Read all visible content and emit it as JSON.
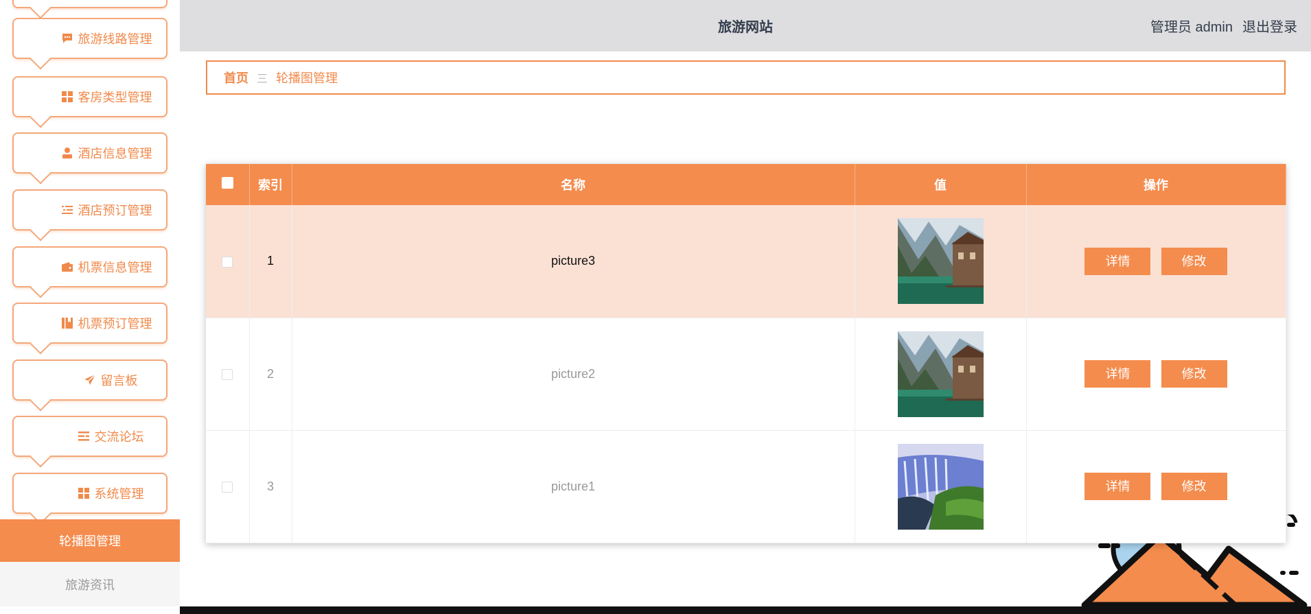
{
  "sidebar": {
    "menu": [
      {
        "label": "旅游线路管理",
        "icon": "message-icon"
      },
      {
        "label": "客房类型管理",
        "icon": "grid-icon"
      },
      {
        "label": "酒店信息管理",
        "icon": "user-icon"
      },
      {
        "label": "酒店预订管理",
        "icon": "list-icon"
      },
      {
        "label": "机票信息管理",
        "icon": "wallet-icon"
      },
      {
        "label": "机票预订管理",
        "icon": "book-icon"
      },
      {
        "label": "留言板",
        "icon": "send-icon"
      },
      {
        "label": "交流论坛",
        "icon": "align-icon"
      },
      {
        "label": "系统管理",
        "icon": "grid-icon"
      }
    ],
    "submenu": [
      {
        "label": "轮播图管理",
        "active": true
      },
      {
        "label": "旅游资讯",
        "active": false
      }
    ]
  },
  "header": {
    "title": "旅游网站",
    "user_label": "管理员 admin",
    "logout_label": "退出登录"
  },
  "breadcrumb": {
    "home": "首页",
    "separator": "三",
    "current": "轮播图管理"
  },
  "table": {
    "columns": [
      "索引",
      "名称",
      "值",
      "操作"
    ],
    "rows": [
      {
        "index": "1",
        "name": "picture3",
        "image": "lake-cabin-photo",
        "highlighted": true
      },
      {
        "index": "2",
        "name": "picture2",
        "image": "lake-cabin-photo",
        "highlighted": false
      },
      {
        "index": "3",
        "name": "picture1",
        "image": "waterfall-photo",
        "highlighted": false
      }
    ],
    "actions": {
      "detail": "详情",
      "edit": "修改"
    }
  },
  "colors": {
    "accent": "#f48c4d",
    "header_bg": "#dedddf",
    "row_highlight": "#fbe1d4"
  }
}
